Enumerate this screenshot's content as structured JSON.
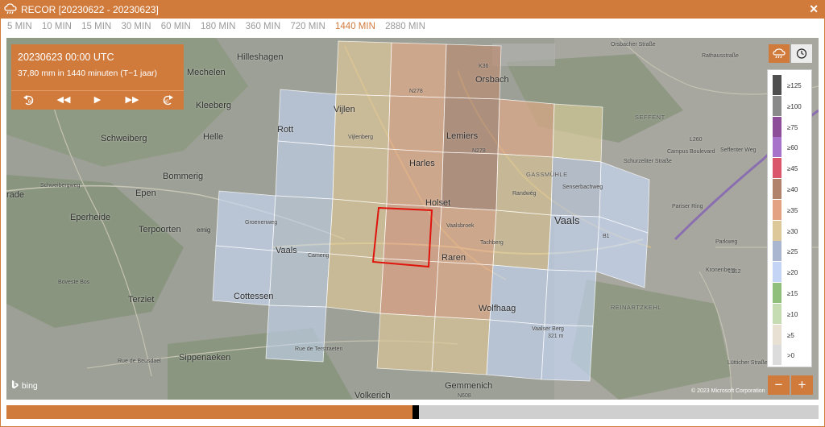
{
  "window": {
    "title": "RECOR [20230622 - 20230623]",
    "close_label": "✕"
  },
  "tabs": [
    {
      "label": "5 MIN",
      "active": false
    },
    {
      "label": "10 MIN",
      "active": false
    },
    {
      "label": "15 MIN",
      "active": false
    },
    {
      "label": "30 MIN",
      "active": false
    },
    {
      "label": "60 MIN",
      "active": false
    },
    {
      "label": "180 MIN",
      "active": false
    },
    {
      "label": "360 MIN",
      "active": false
    },
    {
      "label": "720 MIN",
      "active": false
    },
    {
      "label": "1440 MIN",
      "active": true
    },
    {
      "label": "2880 MIN",
      "active": false
    }
  ],
  "info": {
    "datetime": "20230623 00:00 UTC",
    "amount": "37,80 mm in 1440 minuten (T~1 jaar)"
  },
  "controls": {
    "back_60": "60",
    "rewind": "◀◀",
    "play": "▶",
    "forward": "▶▶",
    "forward_60": "60"
  },
  "legend": [
    {
      "label": "≥125",
      "color": "#4f4f4f"
    },
    {
      "label": "≥100",
      "color": "#8a8a8a"
    },
    {
      "label": "≥75",
      "color": "#8e4d99"
    },
    {
      "label": "≥60",
      "color": "#a772c9"
    },
    {
      "label": "≥45",
      "color": "#d9566b"
    },
    {
      "label": "≥40",
      "color": "#b2836b"
    },
    {
      "label": "≥35",
      "color": "#e3a383"
    },
    {
      "label": "≥30",
      "color": "#ddc89a"
    },
    {
      "label": "≥25",
      "color": "#aab6cf"
    },
    {
      "label": "≥20",
      "color": "#c3d4f4"
    },
    {
      "label": "≥15",
      "color": "#8fbf7a"
    },
    {
      "label": "≥10",
      "color": "#c5dcb3"
    },
    {
      "label": "≥5",
      "color": "#e8e0d2"
    },
    {
      "label": ">0",
      "color": "#dcdcdc"
    }
  ],
  "zoom": {
    "minus": "−",
    "plus": "+"
  },
  "timeline": {
    "progress_fraction": 0.5
  },
  "map": {
    "places": [
      {
        "name": "Hilleshagen"
      },
      {
        "name": "Mechelen"
      },
      {
        "name": "Kleeberg"
      },
      {
        "name": "Schweiberg"
      },
      {
        "name": "Helle"
      },
      {
        "name": "Bommerig"
      },
      {
        "name": "Epen"
      },
      {
        "name": "Eperheide"
      },
      {
        "name": "Terpoorten"
      },
      {
        "name": "Terziet"
      },
      {
        "name": "Sippenaeken"
      },
      {
        "name": "Volkerich"
      },
      {
        "name": "Gemmenich"
      },
      {
        "name": "Wolfhaag"
      },
      {
        "name": "Raren"
      },
      {
        "name": "Vaals"
      },
      {
        "name": "Holset"
      },
      {
        "name": "Harles"
      },
      {
        "name": "Lemiers"
      },
      {
        "name": "Vijlen"
      },
      {
        "name": "Orsbach"
      },
      {
        "name": "Rott"
      },
      {
        "name": "Cottessen"
      },
      {
        "name": "Vaals"
      },
      {
        "name": "rade"
      },
      {
        "name": "emig"
      }
    ],
    "small_labels": [
      "Orsbacher Straße",
      "Rathausstraße",
      "SEFFENT",
      "L260",
      "REINARTZKEHL",
      "GASSMÜHLE",
      "N278",
      "N278",
      "K36",
      "B1",
      "L212",
      "N608",
      "Vaalser Berg",
      "321 m",
      "Vaalsbroek",
      "Tachberg",
      "Rue de Terstraeten",
      "Rue de Beusdael",
      "Boveste Bos",
      "Schweibergweg",
      "Groenenweg",
      "Camerig",
      "Vijlenberg",
      "Randwég",
      "Kronenberg",
      "Seffenter Weg",
      "Campus Boulevard",
      "Parkweg",
      "Pariser Ring",
      "Lütticher Straße",
      "Schurzeliter Straße",
      "Senserbachweg"
    ],
    "attribution": "bing",
    "copyright": "© 2023 Microsoft Corporation"
  }
}
